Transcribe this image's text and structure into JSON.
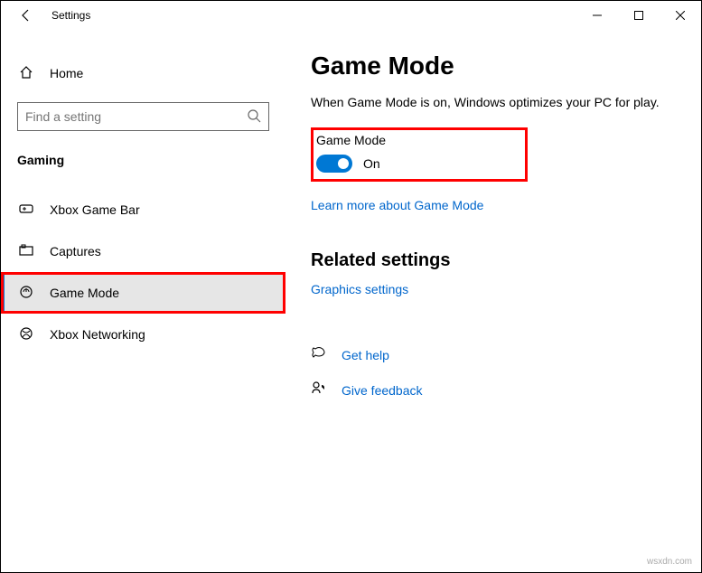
{
  "window": {
    "title": "Settings"
  },
  "sidebar": {
    "home_label": "Home",
    "search_placeholder": "Find a setting",
    "category": "Gaming",
    "items": [
      {
        "label": "Xbox Game Bar"
      },
      {
        "label": "Captures"
      },
      {
        "label": "Game Mode"
      },
      {
        "label": "Xbox Networking"
      }
    ]
  },
  "main": {
    "title": "Game Mode",
    "description": "When Game Mode is on, Windows optimizes your PC for play.",
    "toggle_label": "Game Mode",
    "toggle_state": "On",
    "learn_more": "Learn more about Game Mode",
    "related_header": "Related settings",
    "graphics_link": "Graphics settings",
    "get_help": "Get help",
    "give_feedback": "Give feedback"
  },
  "watermark": "wsxdn.com"
}
